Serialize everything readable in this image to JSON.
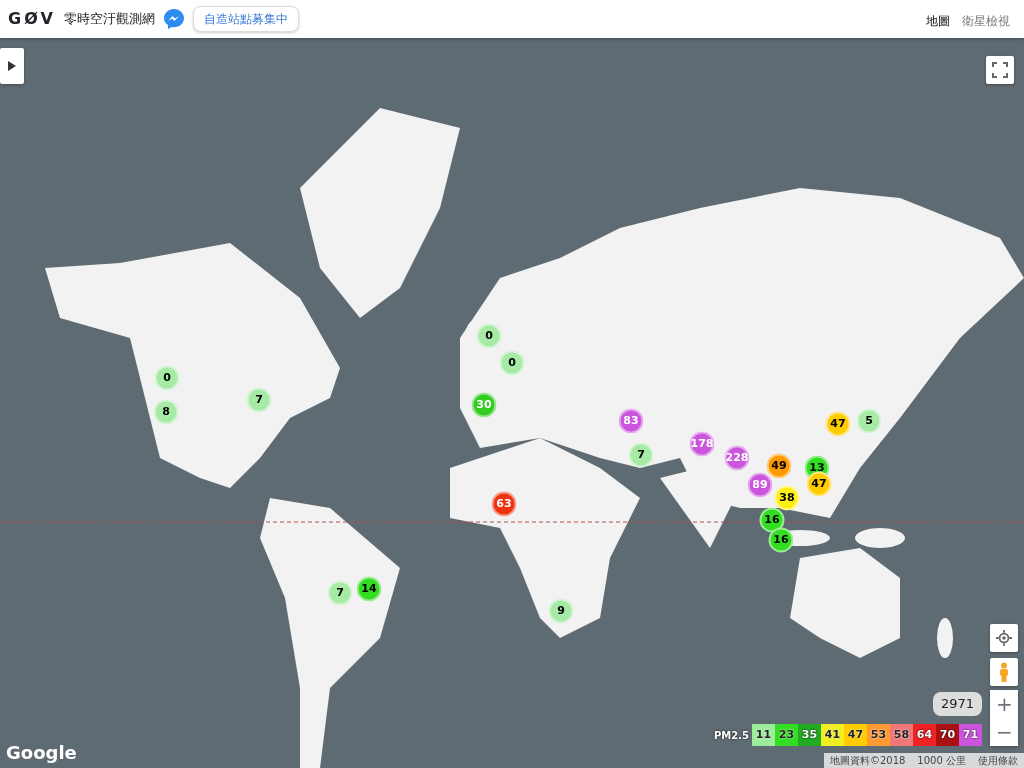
{
  "header": {
    "logo": "GØV",
    "title": "零時空汙觀測網",
    "bubble": "自造站點募集中"
  },
  "map_types": [
    {
      "label": "地圖",
      "selected": true
    },
    {
      "label": "衛星檢視",
      "selected": false
    }
  ],
  "markers": [
    {
      "value": "0",
      "color": "#a6eaa6"
    },
    {
      "value": "0",
      "color": "#a6eaa6"
    },
    {
      "value": "0",
      "color": "#a6eaa6"
    },
    {
      "value": "8",
      "color": "#a6eaa6"
    },
    {
      "value": "7",
      "color": "#a6eaa6"
    },
    {
      "value": "30",
      "color": "#33cc22"
    },
    {
      "value": "83",
      "color": "#cc55dd"
    },
    {
      "value": "7",
      "color": "#a6eaa6"
    },
    {
      "value": "178",
      "color": "#cc55dd"
    },
    {
      "value": "228",
      "color": "#cc55dd"
    },
    {
      "value": "63",
      "color": "#ee3311"
    },
    {
      "value": "49",
      "color": "#ff9900"
    },
    {
      "value": "89",
      "color": "#cc55dd"
    },
    {
      "value": "38",
      "color": "#ffee11"
    },
    {
      "value": "13",
      "color": "#33dd22"
    },
    {
      "value": "47",
      "color": "#ffcc00"
    },
    {
      "value": "47",
      "color": "#ffcc00"
    },
    {
      "value": "5",
      "color": "#a6eaa6"
    },
    {
      "value": "16",
      "color": "#33dd22"
    },
    {
      "value": "16",
      "color": "#33dd22"
    },
    {
      "value": "14",
      "color": "#33dd22"
    },
    {
      "value": "7",
      "color": "#a6eaa6"
    },
    {
      "value": "9",
      "color": "#a6eaa6"
    }
  ],
  "count": "2971",
  "legend": {
    "label": "PM2.5",
    "items": [
      {
        "value": "11",
        "color": "#9cec9c"
      },
      {
        "value": "23",
        "color": "#33dd22"
      },
      {
        "value": "35",
        "color": "#22aa22"
      },
      {
        "value": "41",
        "color": "#eeee22"
      },
      {
        "value": "47",
        "color": "#ffcc00"
      },
      {
        "value": "53",
        "color": "#ff9933"
      },
      {
        "value": "58",
        "color": "#ee7777"
      },
      {
        "value": "64",
        "color": "#ee2222"
      },
      {
        "value": "70",
        "color": "#aa1111"
      },
      {
        "value": "71",
        "color": "#cc55dd"
      }
    ]
  },
  "zoom": {
    "in": "+",
    "out": "−"
  },
  "footer": {
    "brand": "Google",
    "attribution": "地圖資料©2018",
    "scale": "1000 公里",
    "terms": "使用條款"
  }
}
